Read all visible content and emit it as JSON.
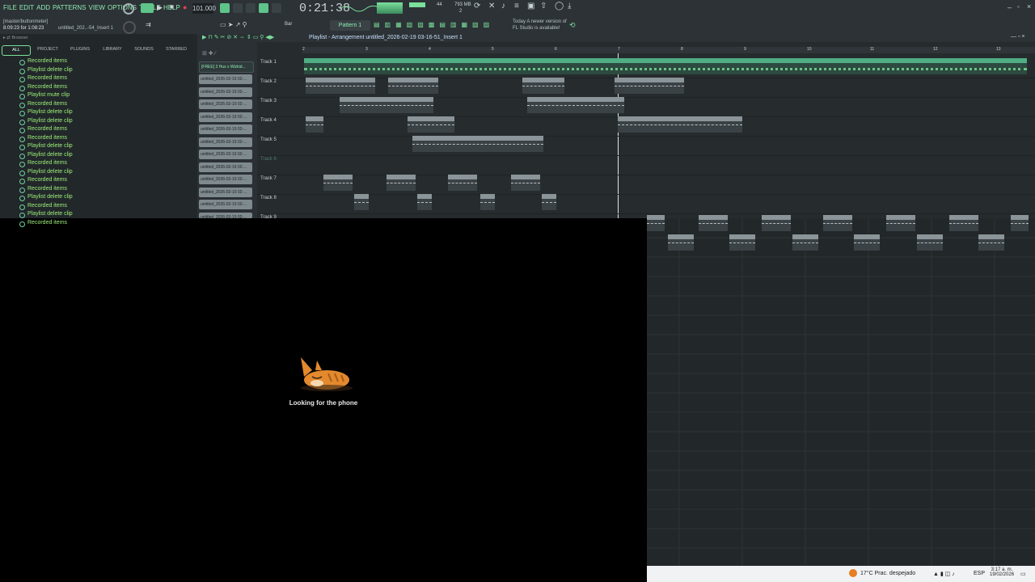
{
  "menu": {
    "items": [
      "FILE",
      "EDIT",
      "ADD",
      "PATTERNS",
      "VIEW",
      "OPTIONS",
      "TOOLS",
      "HELP"
    ]
  },
  "transport": {
    "tempo": "101.000",
    "time": "0:21:38",
    "pattern": "Pattern 1",
    "snap": "Bar",
    "meter_top": "44",
    "memory": "793 MB",
    "cpu": "2"
  },
  "hint": {
    "line1": "[master/buttonmeter]",
    "line2": "8:09:23 for 1:08:23",
    "insert": "untitled_202..-54_Insert 1",
    "news": "Today  A newer version of",
    "news2": "FL Studio is available!"
  },
  "browser": {
    "title": "Browser",
    "tabs": [
      "ALL",
      "PROJECT",
      "PLUGINS",
      "LIBRARY",
      "SOUNDS",
      "STARRED"
    ],
    "items": [
      "Recorded items",
      "Playlist delete clip",
      "Recorded items",
      "Recorded items",
      "Playlist mute clip",
      "Recorded items",
      "Playlist delete clip",
      "Playlist delete clip",
      "Recorded items",
      "Recorded items",
      "Playlist delete clip",
      "Playlist delete clip",
      "Recorded items",
      "Playlist delete clip",
      "Recorded items",
      "Recorded items",
      "Playlist delete clip",
      "Recorded items",
      "Playlist delete clip",
      "Recorded items"
    ]
  },
  "channels": [
    "[FREE] 3 Hus x Wizkid...",
    "untitled_2026-02-19 02-...",
    "untitled_2026-02-19 02-...",
    "untitled_2026-02-19 02-...",
    "untitled_2026-02-19 02-...",
    "untitled_2026-02-19 02-...",
    "untitled_2026-02-19 02-...",
    "untitled_2026-02-19 02-...",
    "untitled_2026-02-19 02-...",
    "untitled_2026-02-19 02-...",
    "untitled_2026-02-19 02-...",
    "untitled_2026-02-19 02-...",
    "untitled_2026-02-19 02-..."
  ],
  "playlist": {
    "title": "Playlist - Arrangement  untitled_2026-02-19 03-16-51_Insert 1",
    "ruler": [
      "2",
      "3",
      "4",
      "5",
      "6",
      "7",
      "8",
      "9",
      "10",
      "11",
      "12",
      "13",
      "14",
      "15",
      "16"
    ],
    "tracks": [
      "Track 1",
      "Track 2",
      "Track 3",
      "Track 4",
      "Track 5",
      "Track 6",
      "Track 7",
      "Track 8",
      "Track 9"
    ],
    "clips": {
      "t1": "[FREE] 3 Hus x Wizkid x Dave x Afro Rap Type Beat - MERCHANT",
      "t2a": "untitled_2026-02-..43-07_Insert 1",
      "t2b": "untitled_20...9_Insert 1",
      "t2c": "untitled_..._Insert 1",
      "t2d": "untitled_2026-02-..-15-31_Insert 1",
      "t3a": "untitled_2026-02-19 02-41-24_Insert 1",
      "t3b": "untitled_2026-02-19 03-16-34_Insert 1",
      "t4a": "unt..1",
      "t4b": "untitled_2...6_Insert 1",
      "t4c": "untitled_2026-02-19 03-16-51_Insert 1",
      "t5a": "untitled_2026-02-19 02-46-49_Insert 1",
      "t7": "untitl...sert 1",
      "t8": "untitl...1 #2"
    }
  },
  "loader": {
    "message": "Looking for the phone"
  },
  "taskbar": {
    "weather": "17°C  Prac. despejado",
    "lang": "ESP",
    "time": "3:17 a. m.",
    "date": "19/02/2026"
  },
  "colors": {
    "accent": "#7be09b",
    "background": "#000000",
    "panel": "#2c3236"
  }
}
